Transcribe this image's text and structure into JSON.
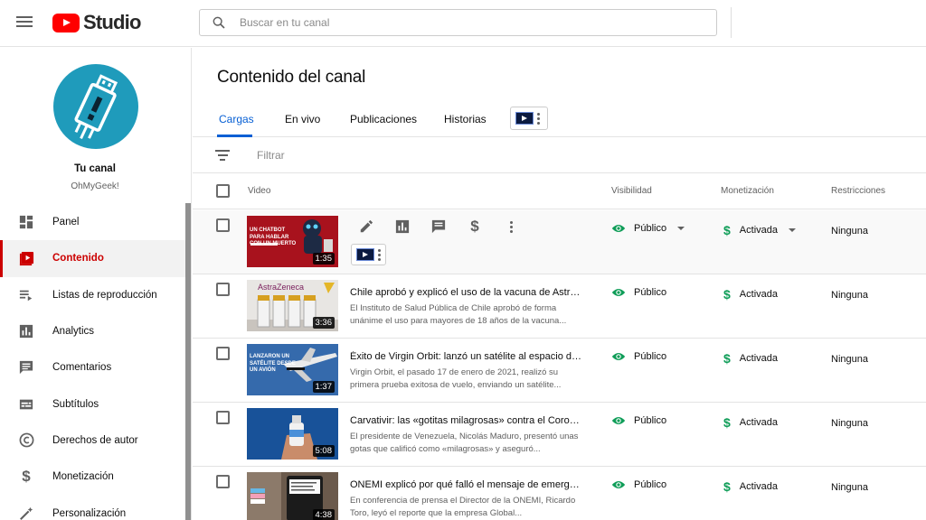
{
  "header": {
    "logo_text": "Studio",
    "search_placeholder": "Buscar en tu canal"
  },
  "sidebar": {
    "channel_title": "Tu canal",
    "channel_name": "OhMyGeek!",
    "items": [
      {
        "label": "Panel",
        "icon": "dashboard-icon"
      },
      {
        "label": "Contenido",
        "icon": "content-icon",
        "active": true
      },
      {
        "label": "Listas de reproducción",
        "icon": "playlist-icon"
      },
      {
        "label": "Analytics",
        "icon": "analytics-icon"
      },
      {
        "label": "Comentarios",
        "icon": "comments-icon"
      },
      {
        "label": "Subtítulos",
        "icon": "subtitles-icon"
      },
      {
        "label": "Derechos de autor",
        "icon": "copyright-icon"
      },
      {
        "label": "Monetización",
        "icon": "dollar-icon"
      },
      {
        "label": "Personalización",
        "icon": "magic-wand-icon"
      }
    ]
  },
  "main": {
    "title": "Contenido del canal",
    "tabs": [
      "Cargas",
      "En vivo",
      "Publicaciones",
      "Historias"
    ],
    "active_tab": "Cargas",
    "filter_label": "Filtrar",
    "columns": {
      "video": "Video",
      "visibility": "Visibilidad",
      "monetization": "Monetización",
      "restrictions": "Restricciones"
    },
    "thumb_text": {
      "chatbot": [
        "UN CHATBOT",
        "PARA HABLAR",
        "CON UN MUERTO"
      ],
      "astrazeneca": "AstraZeneca",
      "virgin": [
        "LANZARON UN",
        "SATÉLITE DESDE",
        "UN AVIÓN"
      ]
    },
    "rows": [
      {
        "duration": "1:35",
        "title": "",
        "description": "",
        "visibility": "Público",
        "monetization": "Activada",
        "restrictions": "Ninguna",
        "hover": true
      },
      {
        "duration": "3:36",
        "title": "Chile aprobó y explicó el uso de la vacuna de Astra...",
        "description": "El Instituto de Salud Pública de Chile aprobó de forma unánime el uso para mayores de 18 años de la vacuna...",
        "visibility": "Público",
        "monetization": "Activada",
        "restrictions": "Ninguna"
      },
      {
        "duration": "1:37",
        "title": "Éxito de Virgin Orbit: lanzó un satélite al espacio de...",
        "description": "Virgin Orbit, el pasado 17 de enero de 2021, realizó su primera prueba exitosa de vuelo, enviando un satélite...",
        "visibility": "Público",
        "monetization": "Activada",
        "restrictions": "Ninguna"
      },
      {
        "duration": "5:08",
        "title": "Carvativir: las «gotitas milagrosas» contra el Coron...",
        "description": "El presidente de Venezuela, Nicolás Maduro, presentó unas gotas que calificó como «milagrosas» y aseguró...",
        "visibility": "Público",
        "monetization": "Activada",
        "restrictions": "Ninguna"
      },
      {
        "duration": "4:38",
        "title": "ONEMI explicó por qué falló el mensaje de emerge...",
        "description": "En conferencia de prensa el Director de la ONEMI, Ricardo Toro, leyó el reporte que la empresa Global...",
        "visibility": "Público",
        "monetization": "Activada",
        "restrictions": "Ninguna"
      }
    ]
  },
  "colors": {
    "accent_blue": "#065fd4",
    "active_red": "#cc0000",
    "brand_red": "#ff0000",
    "status_green": "#0f9d58",
    "avatar_teal": "#1f9bbb"
  }
}
